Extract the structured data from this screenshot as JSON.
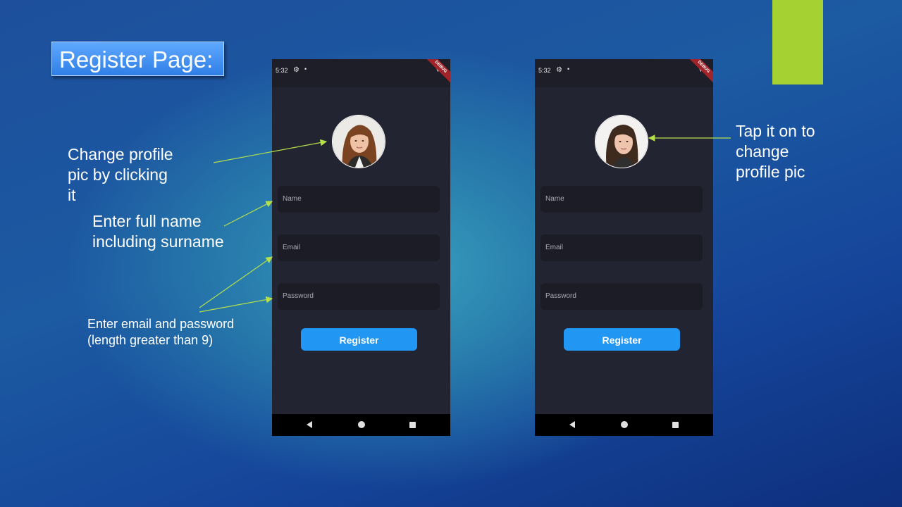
{
  "slide": {
    "title": "Register Page:",
    "accent_color": "#a6d133"
  },
  "annotations": {
    "profile_pic": [
      "Change profile",
      "pic by clicking",
      "it"
    ],
    "full_name": [
      "Enter full name",
      "including surname"
    ],
    "email_password": [
      "Enter email and password",
      "(length greater than 9)"
    ],
    "tap_pic": [
      "Tap it on to",
      "change",
      "profile pic"
    ]
  },
  "phones": [
    {
      "status_time": "5:32",
      "debug_banner": "DEBUG",
      "fields": {
        "name_placeholder": "Name",
        "email_placeholder": "Email",
        "password_placeholder": "Password"
      },
      "register_label": "Register"
    },
    {
      "status_time": "5:32",
      "debug_banner": "DEBUG",
      "fields": {
        "name_placeholder": "Name",
        "email_placeholder": "Email",
        "password_placeholder": "Password"
      },
      "register_label": "Register"
    }
  ],
  "colors": {
    "button": "#2196f3",
    "phone_bg": "#232432",
    "arrow": "#b6e04a"
  },
  "icons": [
    "gear-icon",
    "wifi-icon",
    "battery-icon",
    "nav-back-icon",
    "nav-home-icon",
    "nav-recent-icon",
    "avatar-photo"
  ]
}
